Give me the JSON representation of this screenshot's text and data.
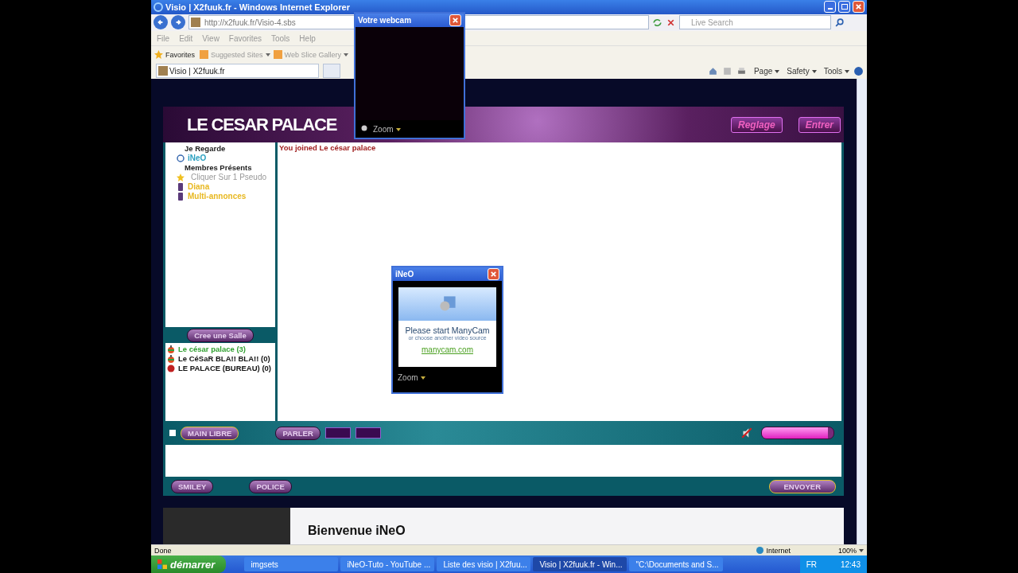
{
  "browser": {
    "title": "Visio | X2fuuk.fr - Windows Internet Explorer",
    "url": "http://x2fuuk.fr/Visio-4.sbs",
    "search_placeholder": "Live Search",
    "menu": [
      "File",
      "Edit",
      "View",
      "Favorites",
      "Tools",
      "Help"
    ],
    "favorites": "Favorites",
    "links": [
      "Suggested Sites",
      "Web Slice Gallery"
    ],
    "tabs": [
      {
        "label": "Visio | X2fuuk.fr",
        "selected": true
      }
    ],
    "commands": [
      "Page",
      "Safety",
      "Tools"
    ]
  },
  "chat": {
    "logo": "LE CESAR PALACE",
    "header_buttons": [
      "Reglage",
      "Entrer"
    ],
    "watching_heading": "Je Regarde",
    "watching": [
      "iNeO"
    ],
    "members_heading": "Membres Présents",
    "members": [
      {
        "name": "Cliquer Sur 1 Pseudo",
        "kind": "hint"
      },
      {
        "name": "Diana",
        "kind": "member"
      },
      {
        "name": "Multi-annonces",
        "kind": "member"
      }
    ],
    "create_room": "Cree une Salle",
    "rooms": [
      {
        "name": "Le césar palace  (3)",
        "selected": true,
        "kind": "apple"
      },
      {
        "name": "Le CéSaR BLA!! BLA!! (0)",
        "selected": false,
        "kind": "apple"
      },
      {
        "name": "LE PALACE (BUREAU) (0)",
        "selected": false,
        "kind": "devil"
      }
    ],
    "messages": [
      "You joined Le césar palace"
    ],
    "hands_free": {
      "label": "MAIN LIBRE",
      "checked": false
    },
    "talk": "PARLER",
    "volume": {
      "level": 0.92
    },
    "bottom_buttons": [
      "SMILEY",
      "POLICE"
    ],
    "send": "ENVOYER"
  },
  "welcome": "Bienvenue iNeO",
  "webcam_window": {
    "title": "Votre webcam",
    "zoom": "Zoom"
  },
  "cam_window": {
    "title": "iNeO",
    "message": "Please start ManyCam",
    "sub": "or choose another video source",
    "link": "manycam.com",
    "zoom": "Zoom"
  },
  "status": {
    "text": "Done",
    "zone": "Internet",
    "zoom": "100%"
  },
  "taskbar": {
    "start": "démarrer",
    "tasks": [
      {
        "label": "imgsets",
        "selected": false
      },
      {
        "label": "iNeO-Tuto - YouTube ...",
        "selected": false
      },
      {
        "label": "Liste des visio | X2fuu...",
        "selected": false
      },
      {
        "label": "Visio | X2fuuk.fr - Win...",
        "selected": true
      },
      {
        "label": "\"C:\\Documents and S...",
        "selected": false
      }
    ],
    "lang": "FR",
    "clock": "12:43"
  }
}
